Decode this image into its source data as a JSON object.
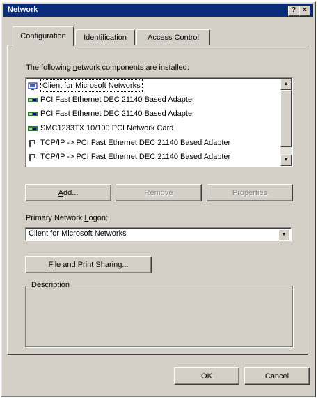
{
  "window": {
    "title": "Network"
  },
  "titlebar": {
    "help": "?",
    "close": "×"
  },
  "tabs": [
    "Configuration",
    "Identification",
    "Access Control"
  ],
  "components": {
    "label_prefix": "The following ",
    "label_mnemonic": "n",
    "label_suffix": "etwork components are installed:",
    "items": [
      {
        "icon": "network-client-icon",
        "text": "Client for Microsoft Networks"
      },
      {
        "icon": "network-adapter-icon",
        "text": "PCI Fast Ethernet DEC 21140 Based Adapter"
      },
      {
        "icon": "network-adapter-icon",
        "text": "PCI Fast Ethernet DEC 21140 Based Adapter"
      },
      {
        "icon": "network-adapter-icon",
        "text": "SMC1233TX 10/100 PCI Network Card"
      },
      {
        "icon": "protocol-icon",
        "text": "TCP/IP -> PCI Fast Ethernet DEC 21140 Based Adapter"
      },
      {
        "icon": "protocol-icon",
        "text": "TCP/IP -> PCI Fast Ethernet DEC 21140 Based Adapter"
      }
    ]
  },
  "buttons": {
    "add_mnemonic": "A",
    "add_rest": "dd...",
    "remove": "Remove",
    "properties": "Properties",
    "file_print_mnemonic": "F",
    "file_print_rest": "ile and Print Sharing...",
    "ok": "OK",
    "cancel": "Cancel"
  },
  "logon": {
    "label_prefix": "Primary Network ",
    "label_mnemonic": "L",
    "label_suffix": "ogon:",
    "value": "Client for Microsoft Networks"
  },
  "description": {
    "label": "Description"
  },
  "icons": {
    "scroll_up": "▲",
    "scroll_down": "▼",
    "dropdown": "▼"
  }
}
